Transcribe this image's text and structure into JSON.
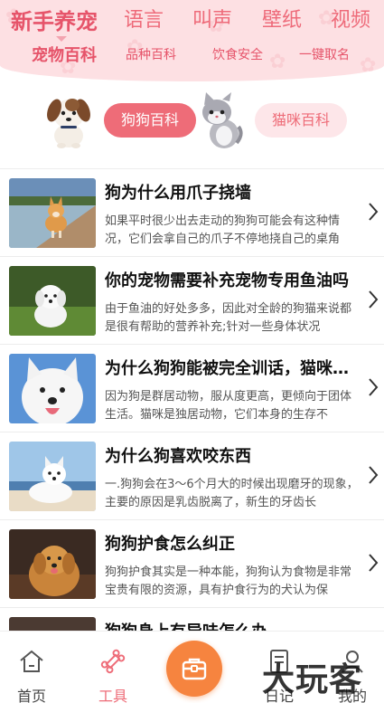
{
  "top_nav": {
    "items": [
      {
        "label": "新手养宠",
        "active": true
      },
      {
        "label": "语言"
      },
      {
        "label": "叫声"
      },
      {
        "label": "壁纸"
      },
      {
        "label": "视频"
      }
    ]
  },
  "sub_nav": {
    "items": [
      {
        "label": "宠物百科",
        "active": true
      },
      {
        "label": "品种百科"
      },
      {
        "label": "饮食安全"
      },
      {
        "label": "一键取名"
      }
    ]
  },
  "categories": {
    "dog": {
      "label": "狗狗百科",
      "active": true
    },
    "cat": {
      "label": "猫咪百科",
      "active": false
    }
  },
  "articles": [
    {
      "title": "狗为什么用爪子挠墙",
      "summary": "如果平时很少出去走动的狗狗可能会有这种情况，它们会拿自己的爪子不停地挠自己的桌角",
      "thumb": "corgi-on-pier"
    },
    {
      "title": "你的宠物需要补充宠物专用鱼油吗",
      "summary": "由于鱼油的好处多多，因此对全龄的狗猫来说都是很有帮助的营养补充;针对一些身体状况",
      "thumb": "white-puppy-on-grass"
    },
    {
      "title": "为什么狗狗能被完全训话，猫咪却不能",
      "summary": "因为狗是群居动物，服从度更高，更倾向于团体生活。猫咪是独居动物，它们本身的生存不",
      "thumb": "white-dog-portrait"
    },
    {
      "title": "为什么狗喜欢咬东西",
      "summary": "一.狗狗会在3～6个月大的时候出现磨牙的现象，主要的原因是乳齿脱离了，新生的牙齿长",
      "thumb": "samoyed-on-beach"
    },
    {
      "title": "狗狗护食怎么纠正",
      "summary": "狗狗护食其实是一种本能，狗狗认为食物是非常宝贵有限的资源，具有护食行为的犬认为保",
      "thumb": "golden-retriever"
    },
    {
      "title": "狗狗身上有异味怎么办",
      "summary": "",
      "thumb": "dog-partial"
    }
  ],
  "tabbar": {
    "items": [
      {
        "label": "首页",
        "icon": "home-icon"
      },
      {
        "label": "工具",
        "icon": "bone-icon",
        "active": true
      },
      {
        "label": "",
        "icon": "toolbox-icon"
      },
      {
        "label": "日记",
        "icon": "diary-icon"
      },
      {
        "label": "我的",
        "icon": "user-icon"
      }
    ]
  },
  "watermark": "大玩客",
  "colors": {
    "brand_pink": "#ee6c78",
    "header_bg": "#fde0e3",
    "center_button": "#f6843f"
  }
}
